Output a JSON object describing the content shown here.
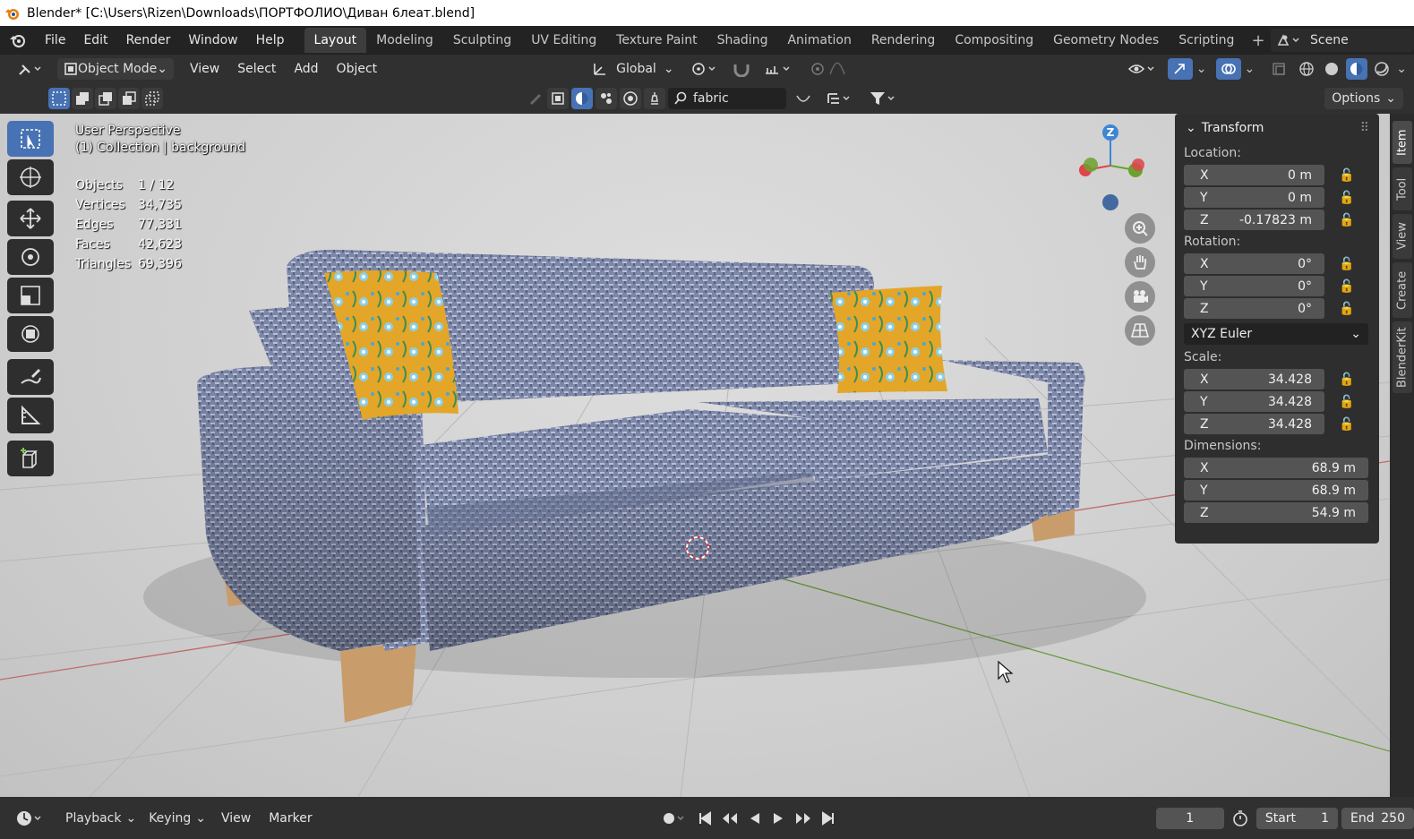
{
  "window": {
    "title": "Blender* [C:\\Users\\Rizen\\Downloads\\ПОРТФОЛИО\\Диван 6леат.blend]"
  },
  "menu": {
    "items": [
      "File",
      "Edit",
      "Render",
      "Window",
      "Help"
    ]
  },
  "workspaces": {
    "tabs": [
      "Layout",
      "Modeling",
      "Sculpting",
      "UV Editing",
      "Texture Paint",
      "Shading",
      "Animation",
      "Rendering",
      "Compositing",
      "Geometry Nodes",
      "Scripting"
    ],
    "active": "Layout"
  },
  "scene": {
    "label": "Scene"
  },
  "header": {
    "mode": "Object Mode",
    "menus": [
      "View",
      "Select",
      "Add",
      "Object"
    ],
    "orientation": "Global"
  },
  "outliner_filter": {
    "search_value": "fabric",
    "options_label": "Options"
  },
  "viewport": {
    "perspective": "User Perspective",
    "collection": "(1) Collection | background",
    "stats": [
      {
        "key": "Objects",
        "value": "1 / 12"
      },
      {
        "key": "Vertices",
        "value": "34,735"
      },
      {
        "key": "Edges",
        "value": "77,331"
      },
      {
        "key": "Faces",
        "value": "42,623"
      },
      {
        "key": "Triangles",
        "value": "69,396"
      }
    ]
  },
  "gizmo": {
    "axis": "Z"
  },
  "npanel": {
    "title": "Transform",
    "location_label": "Location:",
    "location": [
      {
        "axis": "X",
        "value": "0 m"
      },
      {
        "axis": "Y",
        "value": "0 m"
      },
      {
        "axis": "Z",
        "value": "-0.17823 m"
      }
    ],
    "rotation_label": "Rotation:",
    "rotation": [
      {
        "axis": "X",
        "value": "0°"
      },
      {
        "axis": "Y",
        "value": "0°"
      },
      {
        "axis": "Z",
        "value": "0°"
      }
    ],
    "rotation_mode": "XYZ Euler",
    "scale_label": "Scale:",
    "scale": [
      {
        "axis": "X",
        "value": "34.428"
      },
      {
        "axis": "Y",
        "value": "34.428"
      },
      {
        "axis": "Z",
        "value": "34.428"
      }
    ],
    "dimensions_label": "Dimensions:",
    "dimensions": [
      {
        "axis": "X",
        "value": "68.9 m"
      },
      {
        "axis": "Y",
        "value": "68.9 m"
      },
      {
        "axis": "Z",
        "value": "54.9 m"
      }
    ],
    "tabs": [
      "Item",
      "Tool",
      "View",
      "Create",
      "BlenderKit"
    ]
  },
  "timeline": {
    "menus": [
      "Playback",
      "Keying",
      "View",
      "Marker"
    ],
    "current_frame": "1",
    "start_label": "Start",
    "start": "1",
    "end_label": "End",
    "end": "250"
  },
  "colors": {
    "accent": "#4772b3",
    "axis_x": "#e0434b",
    "axis_y": "#6aa22e",
    "axis_z": "#3d86d6",
    "sofa": "#7c86a6",
    "pillow": "#e0a626",
    "legs": "#c79a6a"
  }
}
